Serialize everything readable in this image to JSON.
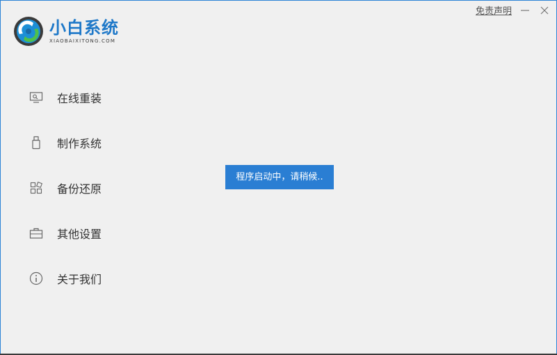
{
  "app": {
    "title": "小白系统",
    "subtitle": "XIAOBAIXITONG.COM",
    "accent_color": "#1e78c8"
  },
  "titlebar": {
    "disclaimer_label": "免责声明",
    "minimize_icon": "minimize-icon",
    "close_icon": "close-icon"
  },
  "sidebar": {
    "items": [
      {
        "label": "在线重装",
        "icon": "monitor-icon"
      },
      {
        "label": "制作系统",
        "icon": "usb-drive-icon"
      },
      {
        "label": "备份还原",
        "icon": "grid-restore-icon"
      },
      {
        "label": "其他设置",
        "icon": "briefcase-icon"
      },
      {
        "label": "关于我们",
        "icon": "info-icon"
      }
    ]
  },
  "toast": {
    "message": "程序启动中，请稍候..",
    "color": "#2a7ed3"
  }
}
